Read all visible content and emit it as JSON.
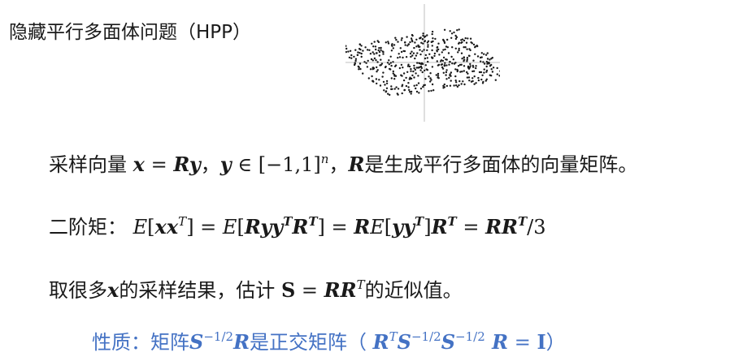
{
  "title": "隐藏平行多面体问题（HPP）",
  "line1": {
    "prefix": "采样向量 ",
    "x": "x",
    "eq1": " = ",
    "Ry": "Ry",
    "sep1": "，",
    "y": "y",
    "in": " ∈ [−1,1]",
    "n": "n",
    "sep2": "，",
    "R": "R",
    "suffix": "是生成平行多面体的向量矩阵。"
  },
  "line2": {
    "prefix": "二阶矩：",
    "E1": "E",
    "br1": "[",
    "xx": "xx",
    "T1": "T",
    "br2": "] = ",
    "E2": "E",
    "br3": "[",
    "Ryy": "Ryy",
    "T2": "T",
    "R2": "R",
    "T3": "T",
    "br4": "] = ",
    "R3": "R",
    "E3": "E",
    "br5": "[",
    "yy": "yy",
    "T4": "T",
    "br6": "]",
    "R4": "R",
    "T5": "T",
    "eq": " = ",
    "RR": "RR",
    "T6": "T",
    "div": "/3"
  },
  "line3": {
    "prefix": "取很多",
    "x": "x",
    "mid": "的采样结果，估计 ",
    "S": "S",
    "eq": " = ",
    "RR": "RR",
    "T": "T",
    "suffix": "的近似值。"
  },
  "property": {
    "prefix": "性质：矩阵",
    "S": "S",
    "exp1": "−1/2",
    "R": "R",
    "mid": "是正交矩阵（ ",
    "R2": "R",
    "T": "T",
    "S2": "S",
    "exp2": "−1/2",
    "S3": "S",
    "exp3": "−1/2",
    "R3": " R",
    "eq": " = ",
    "I": "I",
    "close": "）"
  },
  "colors": {
    "text": "#1a1a1a",
    "accent": "#4472c4",
    "points": "#1a1a1a",
    "axes": "#bfbfbf"
  }
}
